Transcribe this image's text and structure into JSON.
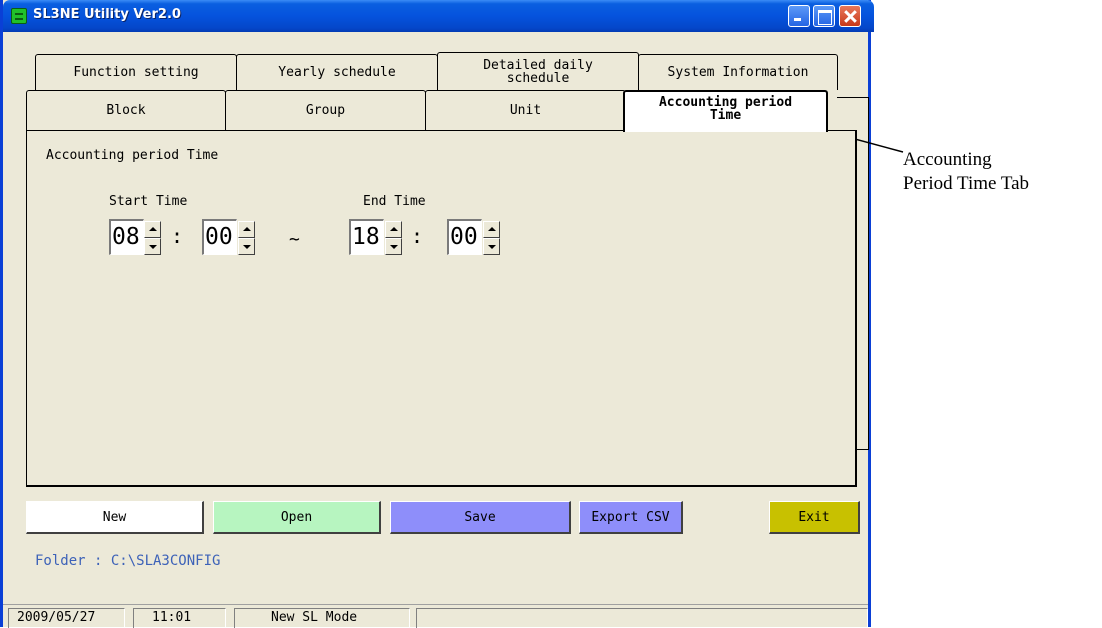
{
  "window": {
    "title": "SL3NE Utility Ver2.0"
  },
  "tabs_back_row": [
    {
      "label": "Function setting"
    },
    {
      "label": "Yearly schedule"
    },
    {
      "label": "Detailed daily schedule"
    },
    {
      "label": "System Information"
    }
  ],
  "tabs_front_row": [
    {
      "label": "Block"
    },
    {
      "label": "Group"
    },
    {
      "label": "Unit"
    },
    {
      "label": "Accounting period Time",
      "selected": true
    }
  ],
  "panel": {
    "heading": "Accounting period Time",
    "start_label": "Start Time",
    "end_label": "End Time",
    "start_hour": "08",
    "start_minute": "00",
    "end_hour": "18",
    "end_minute": "00",
    "colon": ":",
    "tilde": "~"
  },
  "buttons": {
    "new": "New",
    "open": "Open",
    "save": "Save",
    "export_csv": "Export CSV",
    "exit": "Exit"
  },
  "folder_text": "Folder : C:\\SLA3CONFIG",
  "status": {
    "date": "2009/05/27",
    "time": "11:01",
    "mode": "New SL Mode"
  },
  "annotation": {
    "line1": "Accounting",
    "line2": "Period Time Tab"
  },
  "colors": {
    "title_bar": "#0553dd",
    "new_button": "#ffffff",
    "open_button": "#b7f5c0",
    "save_button": "#8e8efa",
    "export_button": "#8e8efa",
    "exit_button": "#c8c100",
    "folder_text": "#3d62b8"
  },
  "icons": [
    "app-icon",
    "minimize-icon",
    "maximize-icon",
    "close-icon",
    "spin-up-icon",
    "spin-down-icon",
    "arrow-icon"
  ]
}
